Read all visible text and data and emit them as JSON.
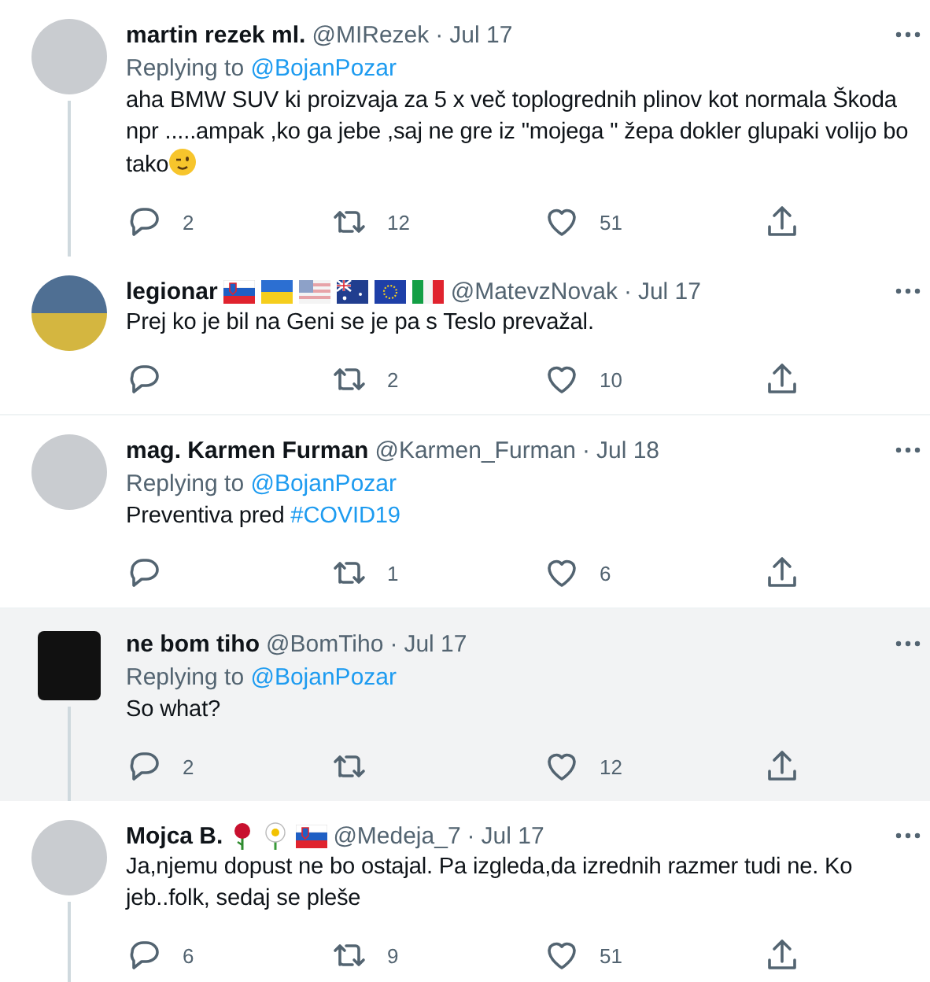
{
  "tweets": [
    {
      "name": "martin rezek ml.",
      "handle": "@MIRezek",
      "separator": "·",
      "date": "Jul 17",
      "avatar": {
        "kind": "photo"
      },
      "replying_to": {
        "label": "Replying to",
        "user": "@BojanPozar"
      },
      "text": [
        {
          "kind": "plain",
          "t": "aha BMW SUV ki proizvaja za 5 x več toplogrednih plinov kot normala Škoda npr .....ampak ,ko ga jebe ,saj ne gre iz \"mojega \" žepa dokler glupaki volijo bo tako"
        },
        {
          "kind": "wink"
        }
      ],
      "thread_line": true,
      "highlighted": false,
      "replies": "2",
      "retweets": "12",
      "likes": "51"
    },
    {
      "name": "legionar",
      "name_icons": [
        {
          "kind": "flag-si"
        },
        {
          "kind": "flag-ua"
        },
        {
          "kind": "flag-us"
        },
        {
          "kind": "flag-au"
        },
        {
          "kind": "flag-eu"
        },
        {
          "kind": "flag-it"
        }
      ],
      "handle": "@MatevzNovak",
      "separator": "·",
      "date": "Jul 17",
      "avatar": {
        "kind": "split"
      },
      "text": [
        {
          "kind": "plain",
          "t": "Prej ko je bil na Geni se je pa s Teslo prevažal."
        }
      ],
      "thread_line": false,
      "highlighted": false,
      "retweets": "2",
      "likes": "10"
    },
    {
      "name": "mag. Karmen Furman",
      "handle": "@Karmen_Furman",
      "separator": "·",
      "date": "Jul 18",
      "avatar": {
        "kind": "photo"
      },
      "replying_to": {
        "label": "Replying to",
        "user": "@BojanPozar"
      },
      "text": [
        {
          "kind": "plain",
          "t": "Preventiva pred "
        },
        {
          "kind": "hashtag",
          "t": "#COVID19"
        }
      ],
      "thread_line": false,
      "highlighted": false,
      "retweets": "1",
      "likes": "6"
    },
    {
      "name": "ne bom tiho",
      "handle": "@BomTiho",
      "separator": "·",
      "date": "Jul 17",
      "avatar": {
        "kind": "square"
      },
      "replying_to": {
        "label": "Replying to",
        "user": "@BojanPozar"
      },
      "text": [
        {
          "kind": "plain",
          "t": "So what?"
        }
      ],
      "thread_line": true,
      "highlighted": true,
      "replies": "2",
      "likes": "12"
    },
    {
      "name": "Mojca B.",
      "name_icons": [
        {
          "kind": "rose"
        },
        {
          "kind": "daisy"
        },
        {
          "kind": "flag-si"
        }
      ],
      "handle": "@Medeja_7",
      "separator": "·",
      "date": "Jul 17",
      "avatar": {
        "kind": "photo"
      },
      "text": [
        {
          "kind": "plain",
          "t": "Ja,njemu dopust ne bo ostajal. Pa izgleda,da izrednih razmer tudi ne. Ko jeb..folk, sedaj se pleše"
        }
      ],
      "thread_line": true,
      "highlighted": false,
      "replies": "6",
      "retweets": "9",
      "likes": "51"
    }
  ]
}
